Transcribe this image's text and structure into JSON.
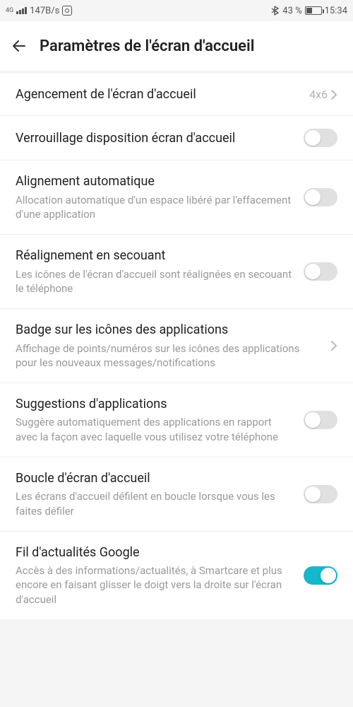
{
  "statusbar": {
    "net_label": "4G",
    "speed": "147B/s",
    "bt_battery": "43 %",
    "time": "15:34"
  },
  "header": {
    "title": "Paramètres de l'écran d'accueil"
  },
  "rows": {
    "layout": {
      "title": "Agencement de l'écran d'accueil",
      "value": "4x6"
    },
    "lock": {
      "title": "Verrouillage disposition écran d'accueil",
      "on": false
    },
    "auto_align": {
      "title": "Alignement automatique",
      "sub": "Allocation automatique d'un espace libéré par l'effacement d'une application",
      "on": false
    },
    "shake_align": {
      "title": "Réalignement en secouant",
      "sub": "Les icônes de l'écran d'accueil sont réalignées en secouant le téléphone",
      "on": false
    },
    "badge": {
      "title": "Badge sur les icônes des applications",
      "sub": "Affichage de points/numéros sur les icônes des applications pour les nouveaux messages/notifications"
    },
    "suggest": {
      "title": "Suggestions d'applications",
      "sub": "Suggère automatiquement des applications en rapport avec la façon avec laquelle vous utilisez votre téléphone",
      "on": false
    },
    "loop": {
      "title": "Boucle d'écran d'accueil",
      "sub": "Les écrans d'accueil défilent en boucle lorsque vous les faites défiler",
      "on": false
    },
    "google": {
      "title": "Fil d'actualités Google",
      "sub": "Accès à des informations/actualités, à Smartcare et plus encore en faisant glisser le doigt vers la droite sur l'écran d'accueil",
      "on": true
    }
  }
}
